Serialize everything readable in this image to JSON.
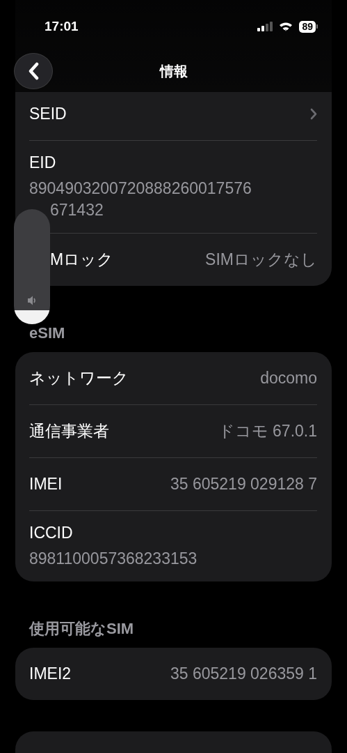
{
  "status_bar": {
    "time": "17:01",
    "battery": "89"
  },
  "nav": {
    "title": "情報"
  },
  "sections": [
    {
      "kind": "card",
      "rows": [
        {
          "kind": "link",
          "label": "SEID"
        },
        {
          "kind": "stacked",
          "label": "EID",
          "value_lines": [
            {
              "text": "8904903200720888260017576",
              "hidden_start": false
            },
            {
              "text": "671432",
              "hidden_start": true
            }
          ]
        },
        {
          "kind": "inline",
          "label": "Mロック",
          "label_hidden_start": true,
          "value": "SIMロックなし"
        }
      ]
    },
    {
      "kind": "card",
      "header": "eSIM",
      "rows": [
        {
          "kind": "inline",
          "label": "ネットワーク",
          "value": "docomo"
        },
        {
          "kind": "inline",
          "label": "通信事業者",
          "value": "ドコモ 67.0.1"
        },
        {
          "kind": "inline",
          "label": "IMEI",
          "value": "35 605219 029128 7"
        },
        {
          "kind": "stacked",
          "label": "ICCID",
          "value_lines": [
            {
              "text": "8981100057368233153",
              "hidden_start": false
            }
          ]
        }
      ]
    },
    {
      "kind": "card",
      "header": "使用可能なSIM",
      "rows": [
        {
          "kind": "inline",
          "label": "IMEI2",
          "value": "35 605219 026359 1"
        }
      ]
    },
    {
      "kind": "cut_off"
    }
  ],
  "volume_hud": {
    "level": 0.12
  }
}
